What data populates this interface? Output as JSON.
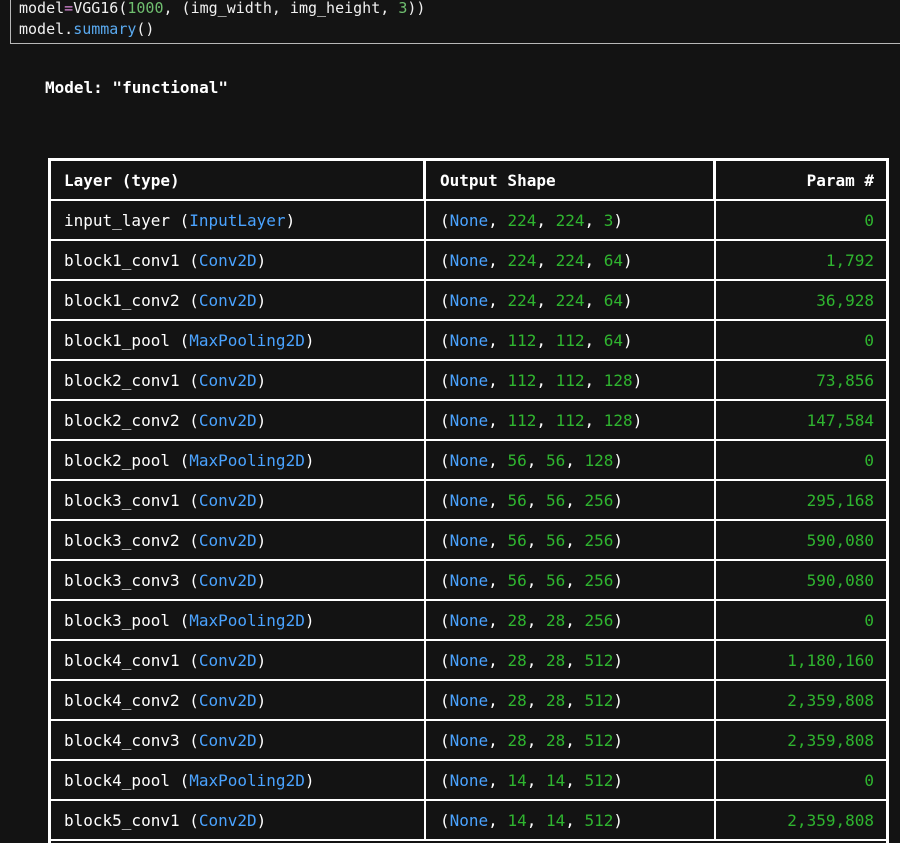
{
  "code": {
    "line1": {
      "prefix": "model",
      "eq": "=",
      "call": "VGG16(",
      "arg1": "1000",
      "mid": ", (img_width, img_height, ",
      "arg2": "3",
      "end": "))"
    },
    "line2": {
      "obj": "model.",
      "method": "summary",
      "end": "()"
    }
  },
  "model_title": "Model: \"functional\"",
  "table": {
    "headers": {
      "layer": "Layer (type)",
      "shape": "Output Shape",
      "param": "Param #"
    },
    "rows": [
      {
        "name": "input_layer",
        "type": "InputLayer",
        "none": "None",
        "dims": [
          "224",
          "224",
          "3"
        ],
        "params": "0"
      },
      {
        "name": "block1_conv1",
        "type": "Conv2D",
        "none": "None",
        "dims": [
          "224",
          "224",
          "64"
        ],
        "params": "1,792"
      },
      {
        "name": "block1_conv2",
        "type": "Conv2D",
        "none": "None",
        "dims": [
          "224",
          "224",
          "64"
        ],
        "params": "36,928"
      },
      {
        "name": "block1_pool",
        "type": "MaxPooling2D",
        "none": "None",
        "dims": [
          "112",
          "112",
          "64"
        ],
        "params": "0"
      },
      {
        "name": "block2_conv1",
        "type": "Conv2D",
        "none": "None",
        "dims": [
          "112",
          "112",
          "128"
        ],
        "params": "73,856"
      },
      {
        "name": "block2_conv2",
        "type": "Conv2D",
        "none": "None",
        "dims": [
          "112",
          "112",
          "128"
        ],
        "params": "147,584"
      },
      {
        "name": "block2_pool",
        "type": "MaxPooling2D",
        "none": "None",
        "dims": [
          "56",
          "56",
          "128"
        ],
        "params": "0"
      },
      {
        "name": "block3_conv1",
        "type": "Conv2D",
        "none": "None",
        "dims": [
          "56",
          "56",
          "256"
        ],
        "params": "295,168"
      },
      {
        "name": "block3_conv2",
        "type": "Conv2D",
        "none": "None",
        "dims": [
          "56",
          "56",
          "256"
        ],
        "params": "590,080"
      },
      {
        "name": "block3_conv3",
        "type": "Conv2D",
        "none": "None",
        "dims": [
          "56",
          "56",
          "256"
        ],
        "params": "590,080"
      },
      {
        "name": "block3_pool",
        "type": "MaxPooling2D",
        "none": "None",
        "dims": [
          "28",
          "28",
          "256"
        ],
        "params": "0"
      },
      {
        "name": "block4_conv1",
        "type": "Conv2D",
        "none": "None",
        "dims": [
          "28",
          "28",
          "512"
        ],
        "params": "1,180,160"
      },
      {
        "name": "block4_conv2",
        "type": "Conv2D",
        "none": "None",
        "dims": [
          "28",
          "28",
          "512"
        ],
        "params": "2,359,808"
      },
      {
        "name": "block4_conv3",
        "type": "Conv2D",
        "none": "None",
        "dims": [
          "28",
          "28",
          "512"
        ],
        "params": "2,359,808"
      },
      {
        "name": "block4_pool",
        "type": "MaxPooling2D",
        "none": "None",
        "dims": [
          "14",
          "14",
          "512"
        ],
        "params": "0"
      },
      {
        "name": "block5_conv1",
        "type": "Conv2D",
        "none": "None",
        "dims": [
          "14",
          "14",
          "512"
        ],
        "params": "2,359,808"
      }
    ]
  },
  "colors": {
    "background": "#131313",
    "layer_type": "#4aa3ff",
    "none_keyword": "#4aa3ff",
    "numbers": "#2fb52f",
    "text": "#ffffff"
  }
}
